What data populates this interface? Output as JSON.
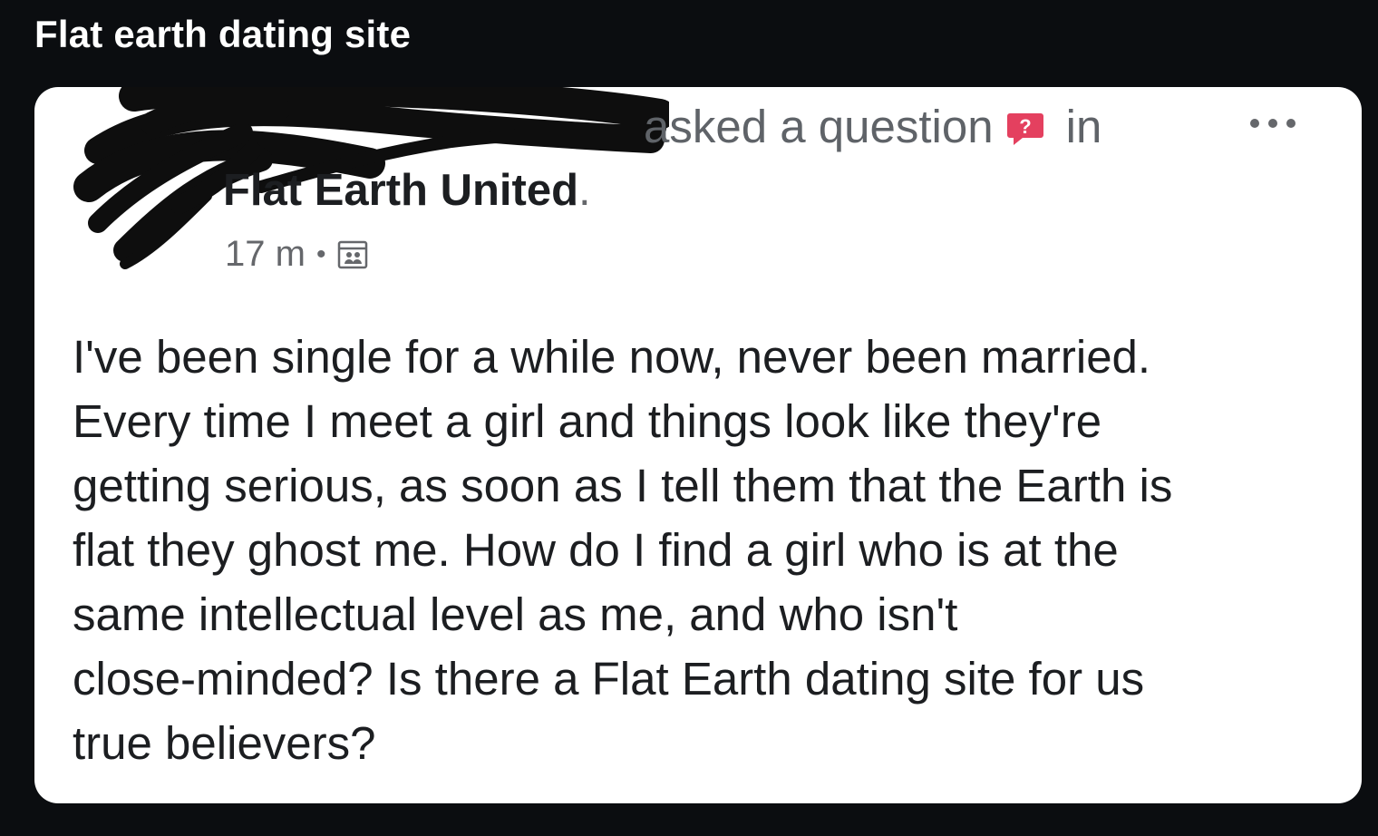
{
  "tweet": {
    "headline": "Flat earth dating site"
  },
  "post": {
    "asked_text": "asked a question",
    "in_text": "in",
    "group_name": "Flat Earth United",
    "group_suffix": ".",
    "time": "17 m",
    "separator": "•",
    "body": "I've been single for a while now, never been married.\nEvery time I meet a girl and things look like they're\ngetting serious, as soon as I tell them that the Earth is\nflat they ghost me. How do I find a girl who is at the\nsame intellectual level as me, and who isn't\nclose-minded? Is there a Flat Earth dating site for us\ntrue believers?",
    "question_badge_glyph": "?"
  },
  "icons": {
    "question": "question-badge-icon",
    "privacy": "group-privacy-icon",
    "more": "more-options-icon",
    "redaction": "redaction-scribble"
  },
  "colors": {
    "page_bg": "#0b0d10",
    "card_bg": "#ffffff",
    "badge": "#e4405f",
    "muted_text": "#65676b"
  }
}
